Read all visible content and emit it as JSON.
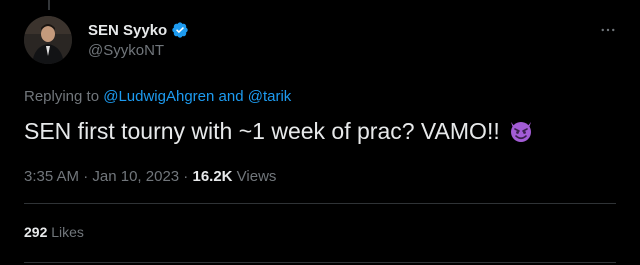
{
  "tweet": {
    "author": {
      "display_name": "SEN Syyko",
      "handle": "@SyykoNT",
      "verified_icon": "verified-badge-icon",
      "avatar": "avatar"
    },
    "more_icon": "more-options-icon",
    "replying_prefix": "Replying to ",
    "replying_user1": "@LudwigAhgren",
    "replying_and": " and ",
    "replying_user2": "@tarik",
    "text": "SEN first tourny with ~1 week of prac? VAMO!!",
    "emoji": "smiling-devil-emoji",
    "time": "3:35 AM",
    "sep1": " · ",
    "date": "Jan 10, 2023",
    "sep2": " · ",
    "views_count": "16.2K",
    "views_label": " Views",
    "likes_count": "292",
    "likes_label": " Likes"
  },
  "colors": {
    "background": "#000000",
    "text": "#e7e9ea",
    "muted": "#71767b",
    "link": "#1d9bf0",
    "divider": "#2f3336",
    "verified": "#1d9bf0",
    "emoji": "#a35cd6"
  }
}
